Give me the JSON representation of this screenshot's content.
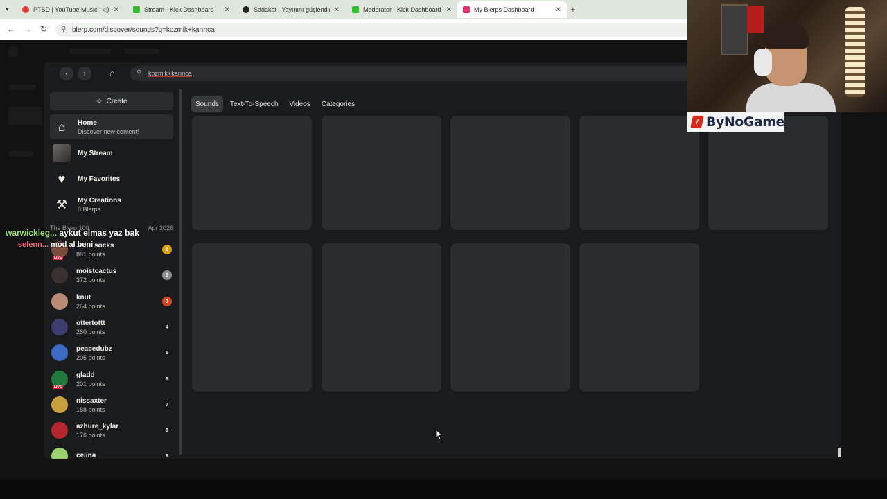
{
  "browser": {
    "tabs": [
      {
        "title": "PTSD | YouTube Music",
        "color": "#e53935"
      },
      {
        "title": "Stream - Kick Dashboard",
        "color": "#2ec02e"
      },
      {
        "title": "Sadakat | Yayınını güçlendirme",
        "color": "#222222"
      },
      {
        "title": "Moderator - Kick Dashboard",
        "color": "#2ec02e"
      },
      {
        "title": "My Blerps Dashboard",
        "color": "#e6336b"
      }
    ],
    "url": "blerp.com/discover/sounds?q=kozmik+karınca"
  },
  "search": {
    "query": "kozmik+karınca"
  },
  "sidebar": {
    "create_label": "Create",
    "nav": [
      {
        "label": "Home",
        "sub": "Discover new content!",
        "icon": "home-icon"
      },
      {
        "label": "My Stream",
        "sub": "",
        "icon": "stream-avatar"
      },
      {
        "label": "My Favorites",
        "sub": "",
        "icon": "heart-icon"
      },
      {
        "label": "My Creations",
        "sub": "0 Blerps",
        "icon": "hammer-icon"
      }
    ],
    "section_title": "The Blerp 100",
    "section_date": "Apr 2026",
    "leaderboard": [
      {
        "name": "...the socks",
        "points": "881 points",
        "rank": "1",
        "rank_color": "#d4a20a",
        "avatar": "#7a4a3a",
        "live": true
      },
      {
        "name": "moistcactus",
        "points": "372 points",
        "rank": "2",
        "rank_color": "#8a8d93",
        "avatar": "#3a3030",
        "live": false
      },
      {
        "name": "knut",
        "points": "264 points",
        "rank": "3",
        "rank_color": "#d9481f",
        "avatar": "#b98a74",
        "live": false
      },
      {
        "name": "ottertottt",
        "points": "260 points",
        "rank": "4",
        "rank_color": "transparent",
        "avatar": "#3b3f6e",
        "live": false
      },
      {
        "name": "peacedubz",
        "points": "205 points",
        "rank": "5",
        "rank_color": "transparent",
        "avatar": "#3b6bc2",
        "live": false
      },
      {
        "name": "gladd",
        "points": "201 points",
        "rank": "6",
        "rank_color": "transparent",
        "avatar": "#1f7a3b",
        "live": true
      },
      {
        "name": "nissaxter",
        "points": "188 points",
        "rank": "7",
        "rank_color": "transparent",
        "avatar": "#c9a03c",
        "live": false
      },
      {
        "name": "azhure_kylar",
        "points": "176 points",
        "rank": "8",
        "rank_color": "transparent",
        "avatar": "#b5272e",
        "live": false
      },
      {
        "name": "celina",
        "points": "",
        "rank": "9",
        "rank_color": "transparent",
        "avatar": "#9bd06a",
        "live": false
      }
    ],
    "live_badge": "LIVE"
  },
  "content_tabs": [
    "Sounds",
    "Text-To-Speech",
    "Videos",
    "Categories"
  ],
  "overlay": {
    "brand": "ByNoGame",
    "chat": [
      {
        "user": "warwickleg...",
        "message": "aykut elmas yaz bak",
        "user_color": "#9fe870",
        "msg_color": "#ffffff"
      },
      {
        "user": "selenn...",
        "message": "mod al beni",
        "user_color": "#ff6b81",
        "msg_color": "#ffffff"
      }
    ]
  }
}
